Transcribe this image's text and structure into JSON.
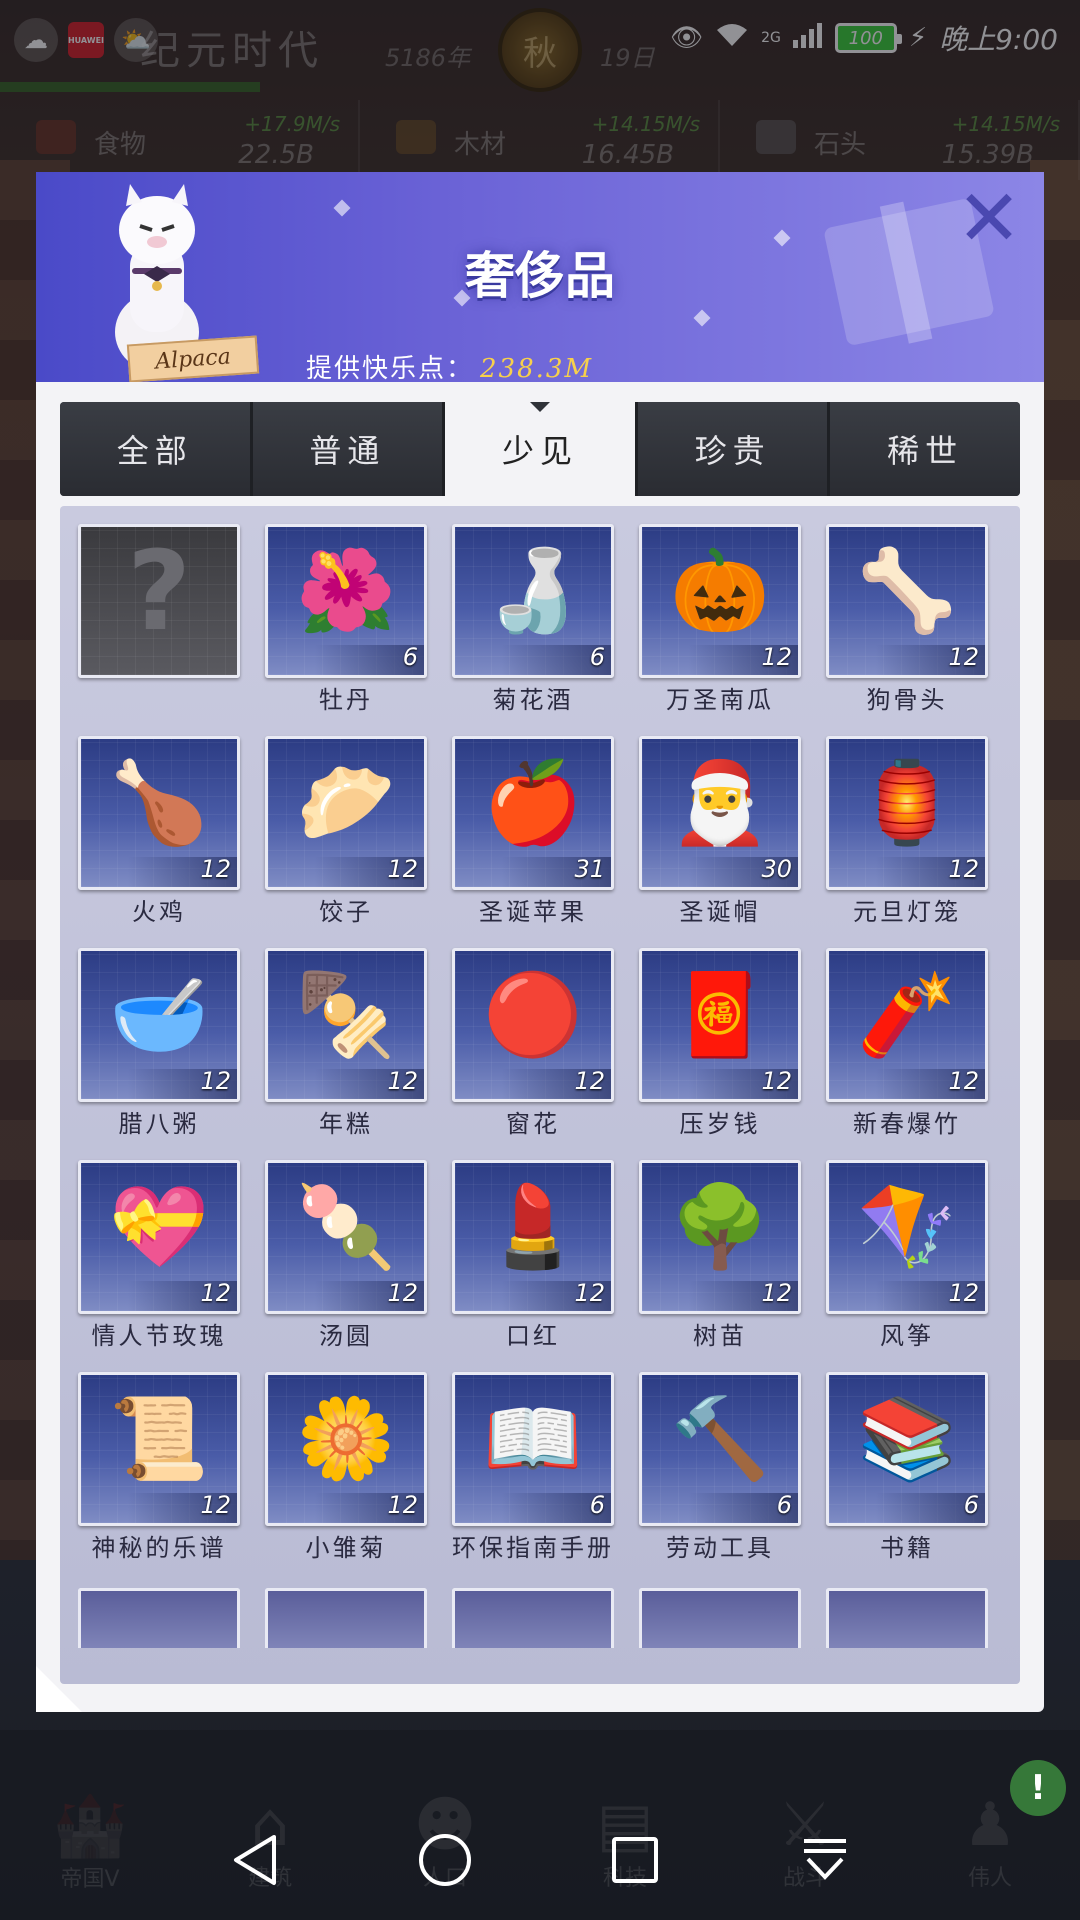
{
  "status_bar": {
    "time": "晚上9:00",
    "battery": "100",
    "network": "2G"
  },
  "game_header": {
    "title": "纪元时代",
    "year": "5186年",
    "season": "秋",
    "day": "19日"
  },
  "resources": [
    {
      "name": "食物",
      "rate": "+17.9M/s",
      "total": "22.5B",
      "icon": "food-icon"
    },
    {
      "name": "木材",
      "rate": "+14.15M/s",
      "total": "16.45B",
      "icon": "wood-icon"
    },
    {
      "name": "石头",
      "rate": "+14.15M/s",
      "total": "15.39B",
      "icon": "stone-icon"
    }
  ],
  "modal": {
    "title": "奢侈品",
    "alpaca_label": "Alpaca",
    "happiness_label": "提供快乐点：",
    "happiness_value": "238.3M",
    "close_icon": "close-icon"
  },
  "tabs": [
    {
      "label": "全部",
      "active": false
    },
    {
      "label": "普通",
      "active": false
    },
    {
      "label": "少见",
      "active": true
    },
    {
      "label": "珍贵",
      "active": false
    },
    {
      "label": "稀世",
      "active": false
    }
  ],
  "items": [
    {
      "name": "",
      "count": "",
      "icon": "?",
      "locked": true
    },
    {
      "name": "牡丹",
      "count": "6",
      "icon": "🌺"
    },
    {
      "name": "菊花酒",
      "count": "6",
      "icon": "🍶"
    },
    {
      "name": "万圣南瓜",
      "count": "12",
      "icon": "🎃"
    },
    {
      "name": "狗骨头",
      "count": "12",
      "icon": "🦴"
    },
    {
      "name": "火鸡",
      "count": "12",
      "icon": "🍗"
    },
    {
      "name": "饺子",
      "count": "12",
      "icon": "🥟"
    },
    {
      "name": "圣诞苹果",
      "count": "31",
      "icon": "🍎"
    },
    {
      "name": "圣诞帽",
      "count": "30",
      "icon": "🎅"
    },
    {
      "name": "元旦灯笼",
      "count": "12",
      "icon": "🏮"
    },
    {
      "name": "腊八粥",
      "count": "12",
      "icon": "🥣"
    },
    {
      "name": "年糕",
      "count": "12",
      "icon": "🍢"
    },
    {
      "name": "窗花",
      "count": "12",
      "icon": "🔴"
    },
    {
      "name": "压岁钱",
      "count": "12",
      "icon": "🧧"
    },
    {
      "name": "新春爆竹",
      "count": "12",
      "icon": "🧨"
    },
    {
      "name": "情人节玫瑰",
      "count": "12",
      "icon": "💝"
    },
    {
      "name": "汤圆",
      "count": "12",
      "icon": "🍡"
    },
    {
      "name": "口红",
      "count": "12",
      "icon": "💄"
    },
    {
      "name": "树苗",
      "count": "12",
      "icon": "🌳"
    },
    {
      "name": "风筝",
      "count": "12",
      "icon": "🪁"
    },
    {
      "name": "神秘的乐谱",
      "count": "12",
      "icon": "📜"
    },
    {
      "name": "小雏菊",
      "count": "12",
      "icon": "🌼"
    },
    {
      "name": "环保指南手册",
      "count": "6",
      "icon": "📖"
    },
    {
      "name": "劳动工具",
      "count": "6",
      "icon": "🔨"
    },
    {
      "name": "书籍",
      "count": "6",
      "icon": "📚"
    }
  ],
  "game_nav": [
    {
      "label": "帝国V",
      "icon": "castle-icon"
    },
    {
      "label": "建筑",
      "icon": "house-icon"
    },
    {
      "label": "人口",
      "icon": "person-icon"
    },
    {
      "label": "科技",
      "icon": "book-icon"
    },
    {
      "label": "战斗",
      "icon": "swords-icon"
    },
    {
      "label": "伟人",
      "icon": "statue-icon"
    }
  ],
  "alert_badge": "!",
  "android_nav": [
    "back-button",
    "home-button",
    "recents-button",
    "notification-down-button"
  ]
}
